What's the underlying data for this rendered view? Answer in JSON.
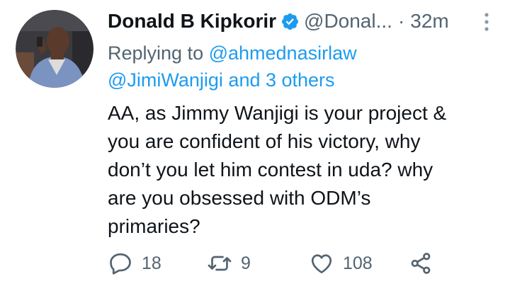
{
  "tweet": {
    "author_name": "Donald B Kipkorir",
    "handle": "@Donal...",
    "separator": "·",
    "time": "32m",
    "replying_prefix": "Replying to ",
    "reply_mention_1": "@ahmednasirlaw",
    "reply_mention_2": "@JimiWanjigi and 3 others",
    "text": "AA, as Jimmy Wanjigi is your project &\nyou are confident of his victory, why\ndon’t you let him contest in uda? why\nare you obsessed with ODM’s\nprimaries?",
    "replies": "18",
    "retweets": "9",
    "likes": "108"
  },
  "colors": {
    "text": "#0f1419",
    "secondary": "#536471",
    "link": "#1d9bf0",
    "verified": "#1d9bf0"
  },
  "icons": {
    "verified": "verified-badge-icon",
    "more": "more-vertical-icon",
    "reply": "speech-bubble-icon",
    "retweet": "retweet-icon",
    "like": "heart-icon",
    "share": "share-icon"
  }
}
